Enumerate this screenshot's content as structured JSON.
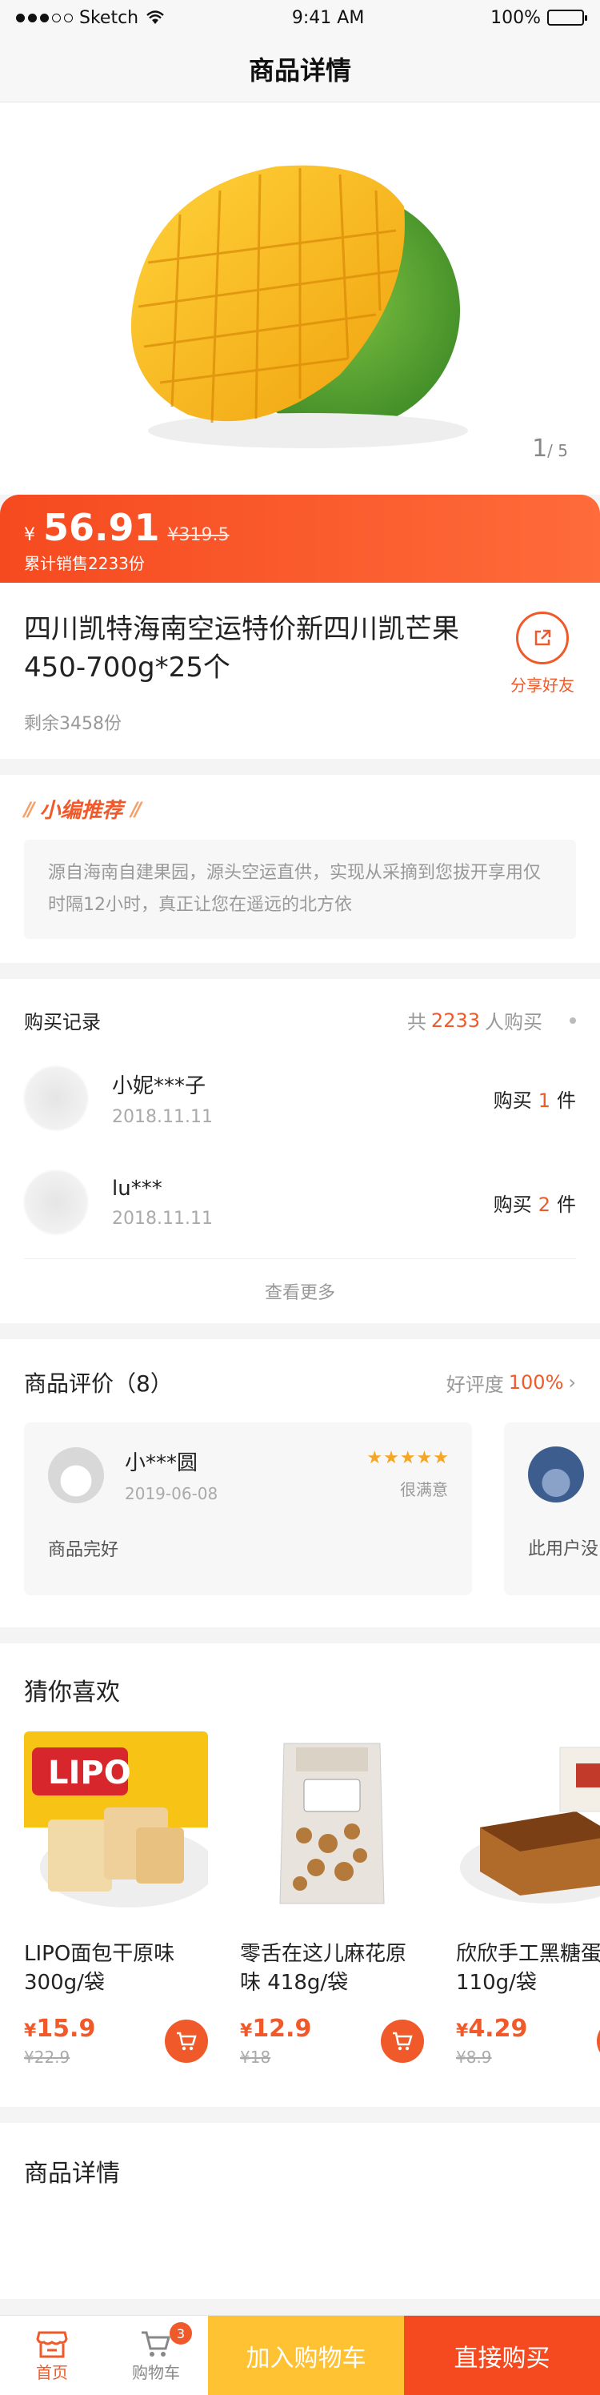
{
  "status": {
    "carrier": "Sketch",
    "time": "9:41 AM",
    "battery": "100%"
  },
  "nav": {
    "title": "商品详情"
  },
  "hero": {
    "page_current": "1",
    "page_total": "/ 5"
  },
  "price": {
    "currency": "¥",
    "current": "56.91",
    "original": "¥319.5",
    "sold": "累计销售2233份"
  },
  "product": {
    "title": "四川凯特海南空运特价新四川凯芒果 450-700g*25个",
    "remain": "剩余3458份",
    "share_label": "分享好友"
  },
  "recommend": {
    "title": "小编推荐",
    "text": "源自海南自建果园，源头空运直供，实现从采摘到您拔开享用仅时隔12小时，真正让您在遥远的北方依"
  },
  "purchase": {
    "label": "购买记录",
    "summary_prefix": "共",
    "summary_count": "2233",
    "summary_suffix": "人购买",
    "records": [
      {
        "name": "小妮***子",
        "date": "2018.11.11",
        "buy_prefix": "购买",
        "qty": "1",
        "unit": "件"
      },
      {
        "name": "lu***",
        "date": "2018.11.11",
        "buy_prefix": "购买",
        "qty": "2",
        "unit": "件"
      }
    ],
    "see_more": "查看更多"
  },
  "reviews": {
    "label": "商品评价（8）",
    "rate_label": "好评度",
    "rate_value": "100%",
    "items": [
      {
        "name": "小***圆",
        "date": "2019-06-08",
        "stars": "★★★★★",
        "satisfaction": "很满意",
        "text": "商品完好"
      },
      {
        "name": "",
        "date": "",
        "stars": "",
        "satisfaction": "",
        "text": "此用户没"
      }
    ]
  },
  "guess": {
    "title": "猜你喜欢",
    "items": [
      {
        "name": "LIPO面包干原味300g/袋",
        "currency": "¥",
        "price": "15.9",
        "old": "¥22.9"
      },
      {
        "name": "零舌在这儿麻花原味 418g/袋",
        "currency": "¥",
        "price": "12.9",
        "old": "¥18"
      },
      {
        "name": "欣欣手工黑糖蛋110g/袋",
        "currency": "¥",
        "price": "4.29",
        "old": "¥8.9"
      }
    ]
  },
  "details": {
    "title": "商品详情"
  },
  "bottom": {
    "home": "首页",
    "cart": "购物车",
    "cart_badge": "3",
    "add_cart": "加入购物车",
    "buy_now": "直接购买"
  },
  "colors": {
    "accent": "#f05a2a",
    "yellow": "#ffc233"
  }
}
